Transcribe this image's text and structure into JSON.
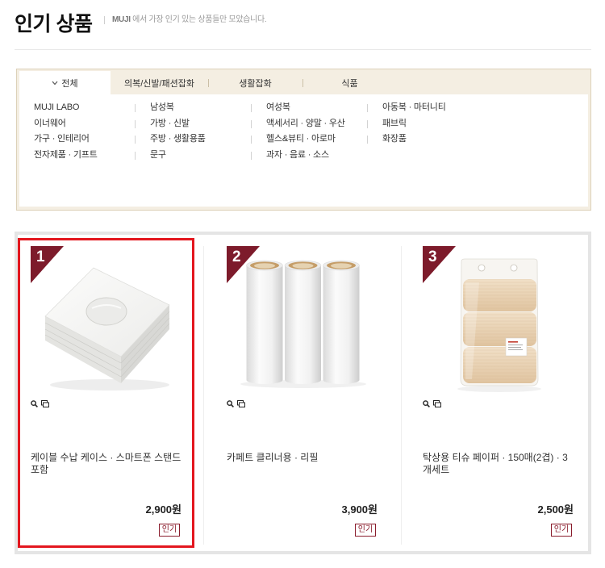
{
  "header": {
    "title": "인기 상품",
    "subtitle_brand": "MUJI",
    "subtitle_text": " 에서 가장 인기 있는 상품들만 모았습니다."
  },
  "category_nav": {
    "tabs": [
      {
        "label": "전체",
        "selected": true,
        "icon": "chevron-down-icon"
      },
      {
        "label": "의복/신발/패션잡화",
        "selected": false
      },
      {
        "label": "생활잡화",
        "selected": false
      },
      {
        "label": "식품",
        "selected": false
      }
    ],
    "columns": [
      [
        "MUJI LABO",
        "이너웨어",
        "가구 · 인테리어",
        "전자제품 · 기프트"
      ],
      [
        "남성복",
        "가방 · 신발",
        "주방 · 생활용품",
        "문구"
      ],
      [
        "여성복",
        "액세서리 · 양말 · 우산",
        "헬스&뷰티 · 아로마",
        "과자 · 음료 · 소스"
      ],
      [
        "아동복 · 마터니티",
        "패브릭",
        "화장품"
      ]
    ]
  },
  "products": [
    {
      "rank": "1",
      "name": "케이블 수납 케이스 · 스마트폰 스탠드 포함",
      "price": "2,900원",
      "badge": "인기",
      "image": "cable-storage-case-image",
      "icons": [
        "zoom-icon",
        "preview-window-icon"
      ],
      "highlighted": true
    },
    {
      "rank": "2",
      "name": "카페트 클리너용 · 리필",
      "price": "3,900원",
      "badge": "인기",
      "image": "lint-roller-refill-image",
      "icons": [
        "zoom-icon",
        "preview-window-icon"
      ],
      "highlighted": false
    },
    {
      "rank": "3",
      "name": "탁상용 티슈 페이퍼 · 150매(2겹) · 3개세트",
      "price": "2,500원",
      "badge": "인기",
      "image": "tissue-paper-pack-image",
      "icons": [
        "zoom-icon",
        "preview-window-icon"
      ],
      "highlighted": false
    }
  ],
  "colors": {
    "rank_badge": "#7d1b2b",
    "selected_outline": "#e3161e",
    "popular_badge": "#8a1c2c",
    "tab_bar": "#f4eee2"
  }
}
